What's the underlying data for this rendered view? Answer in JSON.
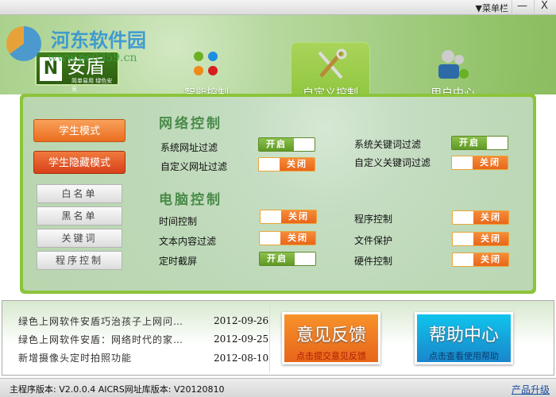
{
  "titlebar": {
    "menu_label": "▼菜单栏",
    "minimize": "—",
    "close": "X"
  },
  "watermark": {
    "name": "河东软件园",
    "url": "www.pc0359.cn"
  },
  "logo": {
    "letter": "N",
    "name": "安盾",
    "slogan": "简单易用  绿色安全"
  },
  "nav": [
    {
      "label": "智能控制",
      "icon": "smart-control-icon"
    },
    {
      "label": "自定义控制",
      "icon": "tools-icon"
    },
    {
      "label": "用户中心",
      "icon": "users-icon"
    }
  ],
  "modes": {
    "student": "学生模式",
    "student_hidden": "学生隐藏模式"
  },
  "lists": {
    "whitelist": "白名单",
    "blacklist": "黑名单",
    "keywords": "关键词",
    "program": "程序控制"
  },
  "network": {
    "title": "网络控制",
    "items": [
      {
        "label": "系统网址过滤",
        "state": "开启",
        "on": true
      },
      {
        "label": "自定义网址过滤",
        "state": "关闭",
        "on": false
      },
      {
        "label": "系统关键词过滤",
        "state": "开启",
        "on": true
      },
      {
        "label": "自定义关键词过滤",
        "state": "关闭",
        "on": false
      }
    ]
  },
  "computer": {
    "title": "电脑控制",
    "items": [
      {
        "label": "时间控制",
        "state": "关闭",
        "on": false
      },
      {
        "label": "文本内容过滤",
        "state": "关闭",
        "on": false
      },
      {
        "label": "定时截屏",
        "state": "开启",
        "on": true
      },
      {
        "label": "程序控制",
        "state": "关闭",
        "on": false
      },
      {
        "label": "文件保护",
        "state": "关闭",
        "on": false
      },
      {
        "label": "硬件控制",
        "state": "关闭",
        "on": false
      }
    ]
  },
  "news": [
    {
      "title": "绿色上网软件安盾巧治孩子上网问…",
      "date": "2012-09-26"
    },
    {
      "title": "绿色上网软件安盾：网络时代的家…",
      "date": "2012-09-25"
    },
    {
      "title": "新增摄像头定时拍照功能",
      "date": "2012-08-10"
    }
  ],
  "feedback": {
    "title": "意见反馈",
    "sub": "点击提交意见反馈"
  },
  "help": {
    "title": "帮助中心",
    "sub": "点击查看使用帮助"
  },
  "status": {
    "version": "主程序版本: V2.0.0.4 AICRS网址库版本: V20120810",
    "upgrade": "产品升级"
  }
}
